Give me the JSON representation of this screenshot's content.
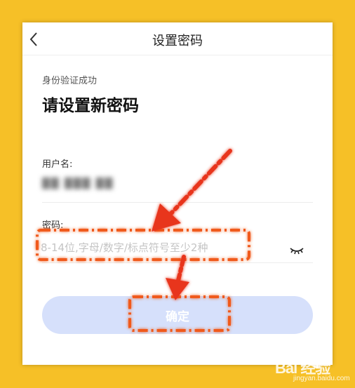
{
  "header": {
    "title": "设置密码",
    "back_icon": "chevron-left-icon"
  },
  "main": {
    "subtitle": "身份验证成功",
    "heading": "请设置新密码",
    "username": {
      "label": "用户名:",
      "value": "██ ███ ██"
    },
    "password": {
      "label": "密码:",
      "placeholder": "8-14位,字母/数字/标点符号至少2种",
      "value": "",
      "toggle_icon": "eye-closed-icon"
    },
    "confirm_label": "确定"
  },
  "colors": {
    "background": "#F6C027",
    "button_disabled": "#D6E0FB",
    "annotation_orange": "#F05A1A",
    "annotation_red": "#E8351E"
  },
  "watermark": {
    "brand": "Bai 经验",
    "url": "jingyan.baidu.com",
    "icon": "paw-icon"
  }
}
